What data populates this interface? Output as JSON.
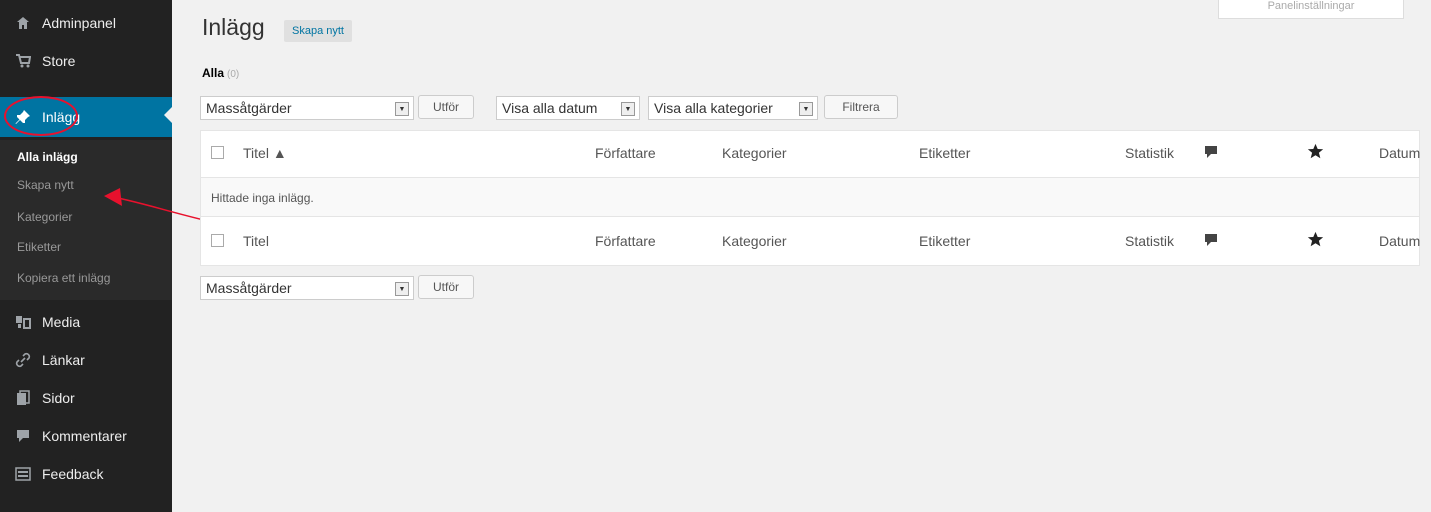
{
  "sidebar": {
    "items": [
      {
        "label": "Adminpanel",
        "icon": "home-icon"
      },
      {
        "label": "Store",
        "icon": "cart-icon"
      },
      {
        "label": "Inlägg",
        "icon": "pin-icon"
      },
      {
        "label": "Media",
        "icon": "media-icon"
      },
      {
        "label": "Länkar",
        "icon": "link-icon"
      },
      {
        "label": "Sidor",
        "icon": "pages-icon"
      },
      {
        "label": "Kommentarer",
        "icon": "comment-icon"
      },
      {
        "label": "Feedback",
        "icon": "feedback-icon"
      }
    ],
    "submenu": [
      {
        "label": "Alla inlägg"
      },
      {
        "label": "Skapa nytt"
      },
      {
        "label": "Kategorier"
      },
      {
        "label": "Etiketter"
      },
      {
        "label": "Kopiera ett inlägg"
      }
    ],
    "active_color": "#0074a2"
  },
  "header": {
    "title": "Inlägg",
    "add_new": "Skapa nytt",
    "screen_options": "Panelinställningar"
  },
  "views": {
    "all_label": "Alla",
    "all_count": "(0)"
  },
  "filters": {
    "bulk_actions": "Massåtgärder",
    "apply": "Utför",
    "dates": "Visa alla datum",
    "categories": "Visa alla kategorier",
    "filter": "Filtrera"
  },
  "table": {
    "columns": {
      "title_sorted": "Titel ▲",
      "title": "Titel",
      "author": "Författare",
      "categories": "Kategorier",
      "tags": "Etiketter",
      "stats": "Statistik",
      "date": "Datum"
    },
    "empty_message": "Hittade inga inlägg."
  },
  "annotation_color": "#e8112d"
}
